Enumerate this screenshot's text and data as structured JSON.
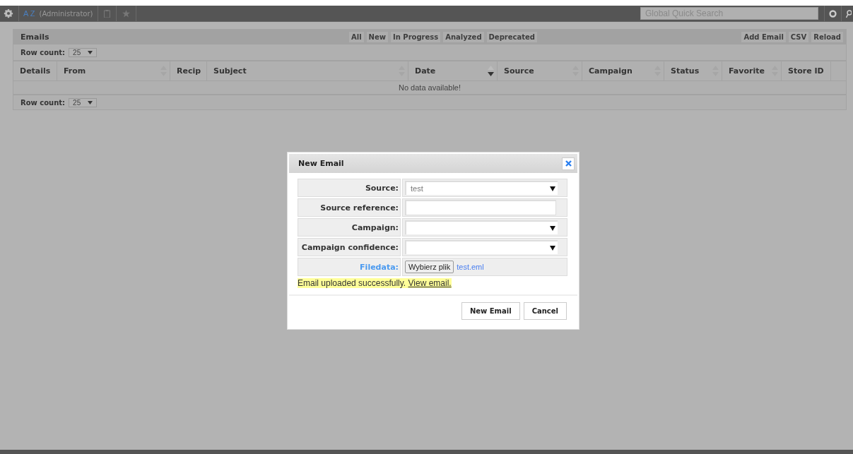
{
  "topbar": {
    "user_initials": "A Z",
    "user_role": "(Administrator)",
    "search": {
      "placeholder": "Global Quick Search"
    }
  },
  "panel": {
    "title": "Emails",
    "filters": [
      "All",
      "New",
      "In Progress",
      "Analyzed",
      "Deprecated"
    ],
    "actions": [
      "Add Email",
      "CSV",
      "Reload"
    ],
    "row_count_top": {
      "label": "Row count:",
      "value": "25"
    },
    "columns": [
      {
        "label": "Details",
        "sortable": false
      },
      {
        "label": "From",
        "sortable": true,
        "sorted_desc": false
      },
      {
        "label": "Recip",
        "sortable": false
      },
      {
        "label": "Subject",
        "sortable": true,
        "sorted_desc": false
      },
      {
        "label": "Date",
        "sortable": true,
        "sorted_desc": true
      },
      {
        "label": "Source",
        "sortable": true,
        "sorted_desc": false
      },
      {
        "label": "Campaign",
        "sortable": true,
        "sorted_desc": false
      },
      {
        "label": "Status",
        "sortable": true,
        "sorted_desc": false
      },
      {
        "label": "Favorite",
        "sortable": true,
        "sorted_desc": false
      },
      {
        "label": "Store ID",
        "sortable": false
      }
    ],
    "row_count_bottom": {
      "label": "Row count:",
      "value": "25"
    },
    "empty_message": "No data available!"
  },
  "dialog": {
    "title": "New Email",
    "fields": [
      {
        "label": "Source:",
        "kind": "select",
        "value": "test"
      },
      {
        "label": "Source reference:",
        "kind": "text"
      },
      {
        "label": "Campaign:",
        "kind": "select"
      },
      {
        "label": "Campaign confidence:",
        "kind": "select"
      },
      {
        "label": "Filedata:",
        "kind": "file",
        "button": "Wybierz plik",
        "value": "test.eml"
      }
    ],
    "message": "Email uploaded successfully.",
    "message_link": "View email.",
    "buttons": [
      "New Email",
      "Cancel"
    ]
  }
}
